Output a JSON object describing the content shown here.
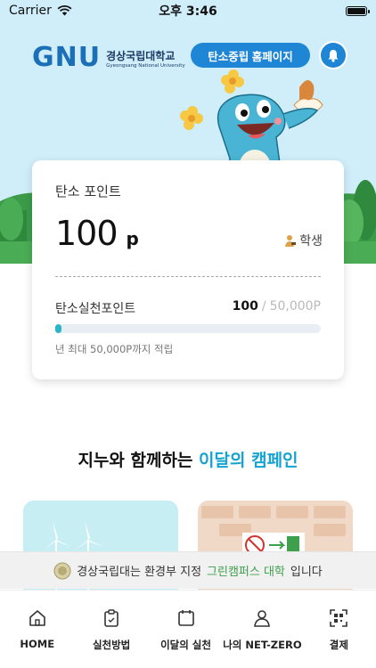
{
  "status_bar": {
    "carrier": "Carrier",
    "time": "오후 3:46"
  },
  "header": {
    "logo_mark": "GNU",
    "logo_name_kr": "경상국립대학교",
    "logo_name_en": "Gyeongsang National University",
    "homepage_button": "탄소중립 홈페이지"
  },
  "points_card": {
    "label": "탄소 포인트",
    "points": "100",
    "unit": "p",
    "member_type": "학생",
    "practice_label": "탄소실천포인트",
    "practice_current": "100",
    "practice_separator": "/",
    "practice_max": "50,000P",
    "progress_fraction": 0.002,
    "note": "년 최대 50,000P까지 적립"
  },
  "campaign": {
    "title_prefix": "지누와 함께하는",
    "title_highlight": "이달의 캠페인"
  },
  "banner": {
    "text_before": "경상국립대는 환경부 지정",
    "text_highlight": "그린캠퍼스 대학",
    "text_after": "입니다"
  },
  "bottom_nav": [
    {
      "label": "HOME",
      "icon": "home-icon"
    },
    {
      "label": "실천방법",
      "icon": "clipboard-icon"
    },
    {
      "label": "이달의 실천",
      "icon": "calendar-icon"
    },
    {
      "label": "나의 NET-ZERO",
      "icon": "person-icon"
    },
    {
      "label": "결제",
      "icon": "qr-code-icon"
    }
  ],
  "colors": {
    "hero_bg": "#cfeefa",
    "accent_blue": "#1f86d6",
    "highlight_cyan": "#16a3cf",
    "progress": "#2ab5c9",
    "green": "#3e9f4c"
  }
}
